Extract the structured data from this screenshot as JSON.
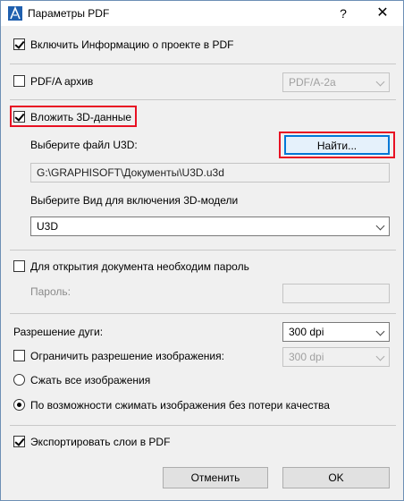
{
  "window": {
    "title": "Параметры PDF",
    "help_label": "?",
    "close_label": "✕",
    "icon": "archicad-icon"
  },
  "include_project_info": {
    "label": "Включить Информацию о проекте в PDF",
    "checked": true
  },
  "pdfa": {
    "label": "PDF/A архив",
    "checked": false,
    "select_value": "PDF/A-2a"
  },
  "embed3d": {
    "label": "Вложить 3D-данные",
    "checked": true,
    "choose_file_label": "Выберите файл U3D:",
    "find_button": "Найти...",
    "file_path": "G:\\GRAPHISOFT\\Документы\\U3D.u3d",
    "choose_view_label": "Выберите Вид для включения 3D-модели",
    "view_value": "U3D"
  },
  "password": {
    "label": "Для открытия документа необходим пароль",
    "checked": false,
    "field_label": "Пароль:",
    "value": ""
  },
  "resolution": {
    "arc_label": "Разрешение дуги:",
    "arc_value": "300 dpi",
    "limit_label": "Ограничить разрешение изображения:",
    "limit_checked": false,
    "limit_value": "300 dpi",
    "compress_all_label": "Сжать все изображения",
    "lossless_label": "По возможности сжимать изображения без потери качества",
    "selected": "lossless"
  },
  "export_layers": {
    "label": "Экспортировать слои в PDF",
    "checked": true
  },
  "buttons": {
    "cancel": "Отменить",
    "ok": "OK"
  },
  "colors": {
    "highlight": "#e81123",
    "focus": "#0078d7"
  }
}
